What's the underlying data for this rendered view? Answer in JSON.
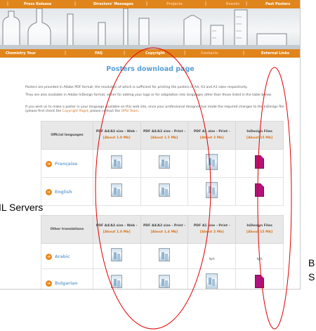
{
  "nav_top": [
    {
      "label": "Press Release",
      "dim": false
    },
    {
      "label": "Directors' Messages",
      "dim": false
    },
    {
      "label": "Projects",
      "dim": true
    },
    {
      "label": "Events",
      "dim": true
    },
    {
      "label": "Past Posters",
      "dim": false
    }
  ],
  "nav_bottom": [
    {
      "label": "Chemistry Your",
      "dim": false
    },
    {
      "label": "FAQ",
      "dim": false
    },
    {
      "label": "Copyright",
      "dim": false
    },
    {
      "label": "Contacts",
      "dim": true
    },
    {
      "label": "External Links",
      "dim": false
    }
  ],
  "page_title": "Posters download page",
  "intro": {
    "p1": "Posters are provided in Adobe PDF format, the resolution of which is sufficient for printing the posters in A4, A3 and A1 sizes respectively.",
    "p2": "They are also available in Adobe InDesign format, either for adding your logo or for adaptation into languages other than those listed in the table below.",
    "p3_a": "If you wish us to make a poster in your language available on this web site, once your professional designer has made the required changes to the InDesign file (please first check the ",
    "p3_link": "Copyright Page",
    "p3_b": "), please contact the ",
    "p3_link2": "OPSI Team",
    "p3_c": "."
  },
  "table1": {
    "header_lang": "Official languages",
    "columns": [
      {
        "title": "PDF A4/A3 size - Web -",
        "size": "[About 1.0 Mb]"
      },
      {
        "title": "PDF A4/A3 size - Print -",
        "size": "[About 1.5 Mb]"
      },
      {
        "title": "PDF A1 size - Print -",
        "size": "[About 2 Mb]"
      },
      {
        "title": "InDesign Files",
        "size": "[About 15 Mb]"
      }
    ],
    "rows": [
      {
        "lang": "Française"
      },
      {
        "lang": "English"
      }
    ]
  },
  "table2": {
    "header_lang": "Other translations",
    "columns": [
      {
        "title": "PDF A4/A3 size - Web -",
        "size": "[About 1.0 Mb]"
      },
      {
        "title": "PDF A4/A3 size - Print -",
        "size": "[About 1.4 Mb]"
      },
      {
        "title": "PDF A1 size - Print -",
        "size": "[About 2 Mb]"
      },
      {
        "title": "InDesign Files",
        "size": "[About 15 Mb]"
      }
    ],
    "rows": [
      {
        "lang": "Arabic",
        "na_a1": "N/A",
        "na_indd": "N/A"
      },
      {
        "lang": "Bulgarian"
      }
    ]
  },
  "annotations": {
    "left_label": "IL Servers",
    "right_label_1": "B",
    "right_label_2": "S",
    "ellipse_color": "#e00000"
  }
}
